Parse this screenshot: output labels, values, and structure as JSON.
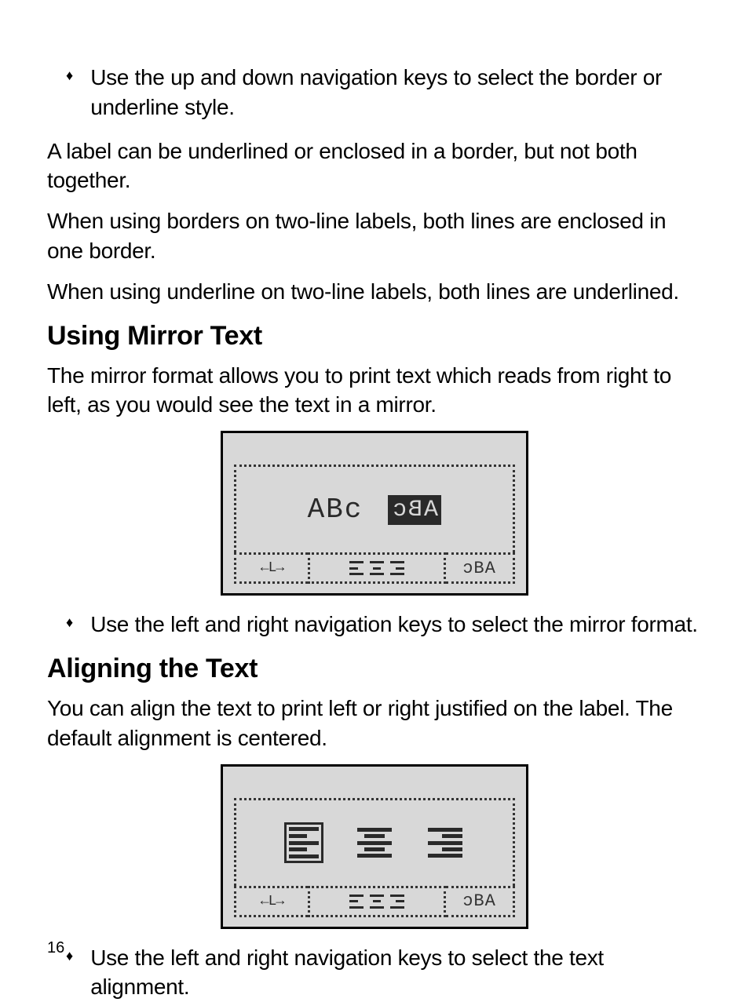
{
  "page_number": "16",
  "bullets": {
    "b1": "Use the up and down navigation keys to select the border or underline style.",
    "b2": "Use the left and right navigation keys to select the mirror format.",
    "b3": "Use the left and right navigation keys to select the text alignment."
  },
  "paragraphs": {
    "p1": "A label can be underlined or enclosed in a border, but not both together.",
    "p2": "When using borders on two-line labels, both lines are enclosed in one border.",
    "p3": "When using underline on two-line labels, both lines are underlined.",
    "p4": "The mirror format allows you to print text which reads from right to left, as you would see the text in a mirror.",
    "p5": "You can align the text to print left or right justified on the label. The default alignment is centered."
  },
  "headings": {
    "h1": "Using Mirror Text",
    "h2": "Aligning the Text"
  },
  "lcd1": {
    "normal_text": "ABc",
    "mirror_text": "ABc",
    "nav_hint": "←L→",
    "status_right": "ɔBA"
  },
  "lcd2": {
    "nav_hint": "←L→",
    "status_right": "ɔBA"
  }
}
